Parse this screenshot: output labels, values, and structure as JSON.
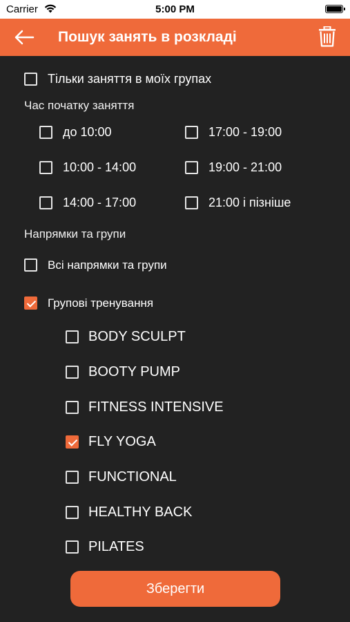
{
  "status_bar": {
    "carrier": "Carrier",
    "time": "5:00 PM"
  },
  "header": {
    "title": "Пошук занять в розкладі",
    "back_icon": "arrow-left-icon",
    "delete_icon": "trash-icon"
  },
  "colors": {
    "accent": "#ef6a3a",
    "background": "#222222"
  },
  "my_groups_only": {
    "label": "Тільки заняття в моїх групах",
    "checked": false
  },
  "start_time": {
    "heading": "Час початку заняття",
    "options": [
      {
        "label": "до 10:00",
        "checked": false
      },
      {
        "label": "17:00 - 19:00",
        "checked": false
      },
      {
        "label": "10:00 - 14:00",
        "checked": false
      },
      {
        "label": "19:00 - 21:00",
        "checked": false
      },
      {
        "label": "14:00 - 17:00",
        "checked": false
      },
      {
        "label": "21:00 і пізніше",
        "checked": false
      }
    ]
  },
  "directions": {
    "heading": "Напрямки та групи",
    "all": {
      "label": "Всі напрямки та групи",
      "checked": false
    },
    "group_training": {
      "label": "Групові тренування",
      "checked": true,
      "items": [
        {
          "label": "BODY SCULPT",
          "checked": false
        },
        {
          "label": "BOOTY PUMP",
          "checked": false
        },
        {
          "label": "FITNESS INTENSIVE",
          "checked": false
        },
        {
          "label": "FLY YOGA",
          "checked": true
        },
        {
          "label": "FUNCTIONAL",
          "checked": false
        },
        {
          "label": "HEALTHY BACK",
          "checked": false
        },
        {
          "label": "PILATES",
          "checked": false
        }
      ]
    }
  },
  "save_button": {
    "label": "Зберегти"
  }
}
